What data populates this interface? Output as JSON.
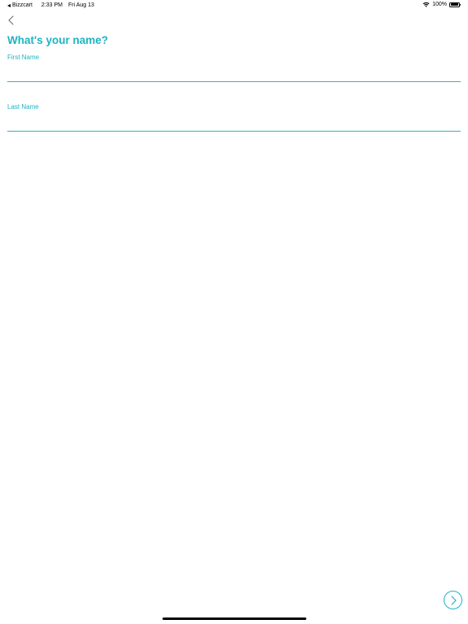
{
  "status_bar": {
    "back_app": "Bizzcart",
    "time": "2:33 PM",
    "date": "Fri Aug 13",
    "battery": "100%",
    "battery_level": 1.0,
    "icons": [
      "back-arrow-icon",
      "wifi-icon",
      "battery-icon"
    ]
  },
  "nav": {
    "back_icon": "chevron-left-icon"
  },
  "form": {
    "title": "What's your name?",
    "first_name": {
      "label": "First Name",
      "value": "",
      "placeholder": ""
    },
    "last_name": {
      "label": "Last Name",
      "value": "",
      "placeholder": ""
    }
  },
  "footer": {
    "next_icon": "chevron-right-icon"
  },
  "colors": {
    "accent": "#1fb3c2",
    "background": "#ffffff",
    "text": "#000000"
  }
}
